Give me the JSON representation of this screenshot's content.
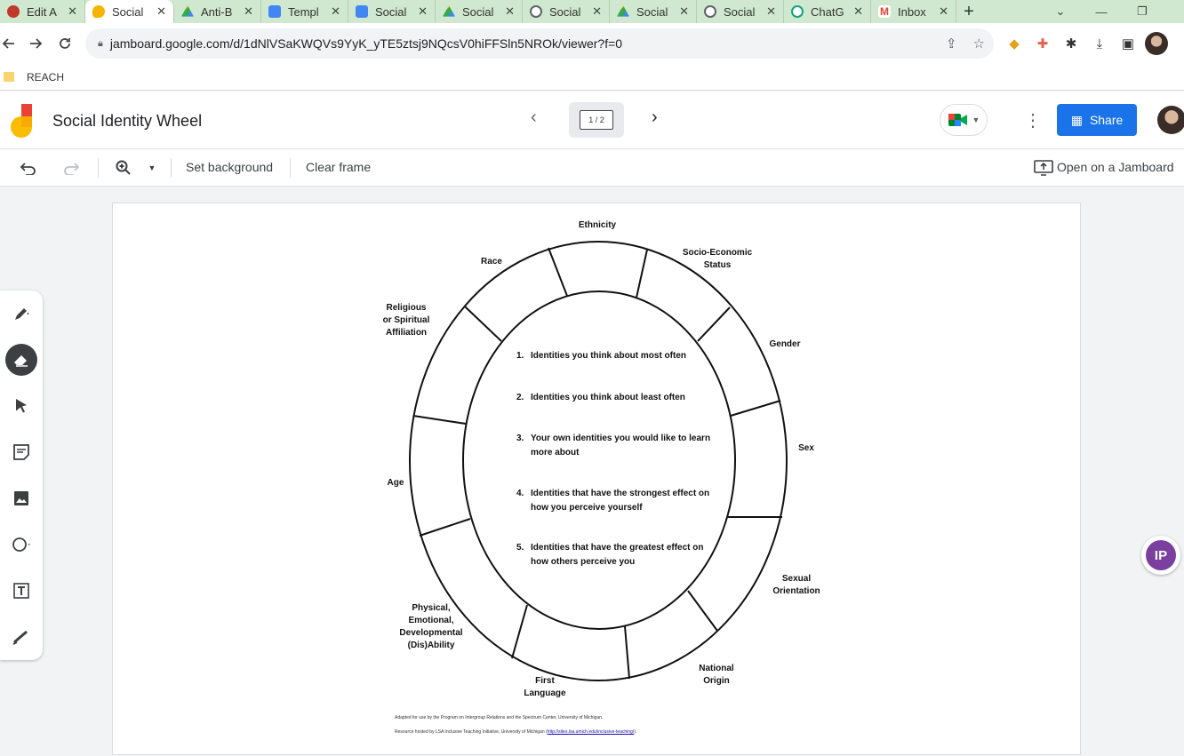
{
  "browser": {
    "tabs": [
      {
        "title": "Edit A",
        "favicon_color": "#c0392b",
        "active": false
      },
      {
        "title": "Social",
        "favicon_color": "#f4b400",
        "active": true
      },
      {
        "title": "Anti-B",
        "favicon_color": "#34a853",
        "active": false
      },
      {
        "title": "Templ",
        "favicon_color": "#4285f4",
        "active": false
      },
      {
        "title": "Social",
        "favicon_color": "#4285f4",
        "active": false
      },
      {
        "title": "Social",
        "favicon_color": "#34a853",
        "active": false
      },
      {
        "title": "Social",
        "favicon_color": "#5f6368",
        "active": false
      },
      {
        "title": "Social",
        "favicon_color": "#34a853",
        "active": false
      },
      {
        "title": "Social",
        "favicon_color": "#5f6368",
        "active": false
      },
      {
        "title": "ChatG",
        "favicon_color": "#10a37f",
        "active": false
      },
      {
        "title": "Inbox",
        "favicon_color": "#ea4335",
        "active": false
      }
    ],
    "url": "jamboard.google.com/d/1dNlVSaKWQVs9YyK_yTE5ztsj9NQcsV0hiFFSln5NROk/viewer?f=0",
    "bookmark_folder": "REACH"
  },
  "jam": {
    "title": "Social Identity Wheel",
    "frame_counter": "1 / 2",
    "share_label": "Share",
    "toolbar": {
      "set_background": "Set background",
      "clear_frame": "Clear frame",
      "open_on_jamboard": "Open on a Jamboard"
    }
  },
  "wheel": {
    "labels": {
      "ethnicity": "Ethnicity",
      "ses_1": "Socio-Economic",
      "ses_2": "Status",
      "race": "Race",
      "religion_1": "Religious",
      "religion_2": "or Spiritual",
      "religion_3": "Affiliation",
      "gender": "Gender",
      "sex": "Sex",
      "age": "Age",
      "sexual_1": "Sexual",
      "sexual_2": "Orientation",
      "ability_1": "Physical,",
      "ability_2": "Emotional,",
      "ability_3": "Developmental",
      "ability_4": "(Dis)Ability",
      "language_1": "First",
      "language_2": "Language",
      "national_1": "National",
      "national_2": "Origin"
    },
    "questions": [
      {
        "num": "1.",
        "line1": "Identities you think about most often",
        "line2": ""
      },
      {
        "num": "2.",
        "line1": "Identities you think about least often",
        "line2": ""
      },
      {
        "num": "3.",
        "line1": "Your own identities you would like to learn",
        "line2": "more about"
      },
      {
        "num": "4.",
        "line1": "Identities that have the strongest effect on",
        "line2": "how you perceive yourself"
      },
      {
        "num": "5.",
        "line1": "Identities that have the greatest effect on",
        "line2": "how others perceive you"
      }
    ],
    "footer_line1": "Adapted for use by the Program on Intergroup Relations and the Spectrum Center, University of Michigan.",
    "footer_line2": "Resource hosted by LSA Inclusive Teaching Initiative, University of Michigan (",
    "footer_link": "http://sites.lsa.umich.edu/inclusive-teaching/",
    "footer_line2_end": ")."
  },
  "icons": {
    "pen": "pen-icon",
    "eraser": "eraser-icon",
    "select": "cursor-icon",
    "sticky_note": "sticky-note-icon",
    "image": "image-icon",
    "circle": "shape-icon",
    "text": "text-box-icon",
    "laser": "laser-icon"
  },
  "extension_badge": "IP"
}
